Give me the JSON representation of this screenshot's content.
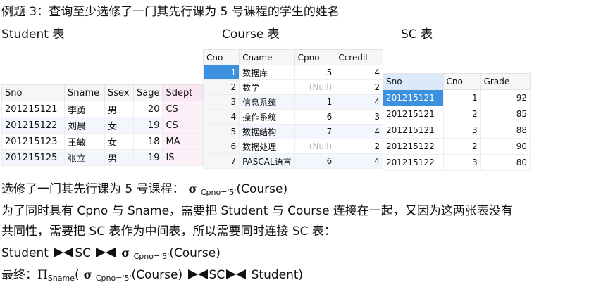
{
  "title": "例题 3：查询至少选修了一门其先行课为 5 号课程的学生的姓名",
  "labels": {
    "student": "Student 表",
    "course": "Course 表",
    "sc": "SC 表"
  },
  "student_table": {
    "headers": [
      "Sno",
      "Sname",
      "Ssex",
      "Sage",
      "Sdept"
    ],
    "rows": [
      [
        "201215121",
        "李勇",
        "男",
        "20",
        "CS"
      ],
      [
        "201215122",
        "刘晨",
        "女",
        "19",
        "CS"
      ],
      [
        "201215123",
        "王敏",
        "女",
        "18",
        "MA"
      ],
      [
        "201215125",
        "张立",
        "男",
        "19",
        "IS"
      ]
    ]
  },
  "course_table": {
    "headers": [
      "Cno",
      "Cname",
      "Cpno",
      "Ccredit"
    ],
    "rows": [
      [
        "1",
        "数据库",
        "5",
        "4"
      ],
      [
        "2",
        "数学",
        "(Null)",
        "2"
      ],
      [
        "3",
        "信息系统",
        "1",
        "4"
      ],
      [
        "4",
        "操作系统",
        "6",
        "3"
      ],
      [
        "5",
        "数据结构",
        "7",
        "4"
      ],
      [
        "6",
        "数据处理",
        "(Null)",
        "2"
      ],
      [
        "7",
        "PASCAL语言",
        "6",
        "4"
      ]
    ]
  },
  "sc_table": {
    "headers": [
      "Sno",
      "Cno",
      "Grade"
    ],
    "rows": [
      [
        "201215121",
        "1",
        "92"
      ],
      [
        "201215121",
        "2",
        "85"
      ],
      [
        "201215121",
        "3",
        "88"
      ],
      [
        "201215122",
        "2",
        "90"
      ],
      [
        "201215122",
        "3",
        "80"
      ]
    ]
  },
  "text": {
    "line1_prefix": "选修了一门其先行课为 5 号课程：",
    "sigma": "σ",
    "cond": "Cpno='5'",
    "course_arg": "(Course)",
    "para1": "为了同时具有 Cpno 与 Sname，需要把 Student 与 Course 连接在一起，又因为这两张表没有",
    "para2": "共同性，需要把 SC 表作为中间表，所以需要同时连接 SC 表：",
    "expr_student": "Student",
    "expr_sc": "SC",
    "final_prefix": "最终：",
    "pi": "Π",
    "pi_sub": "Sname",
    "open_paren": "(",
    "close_paren": ")",
    "final_student": "Student)"
  }
}
